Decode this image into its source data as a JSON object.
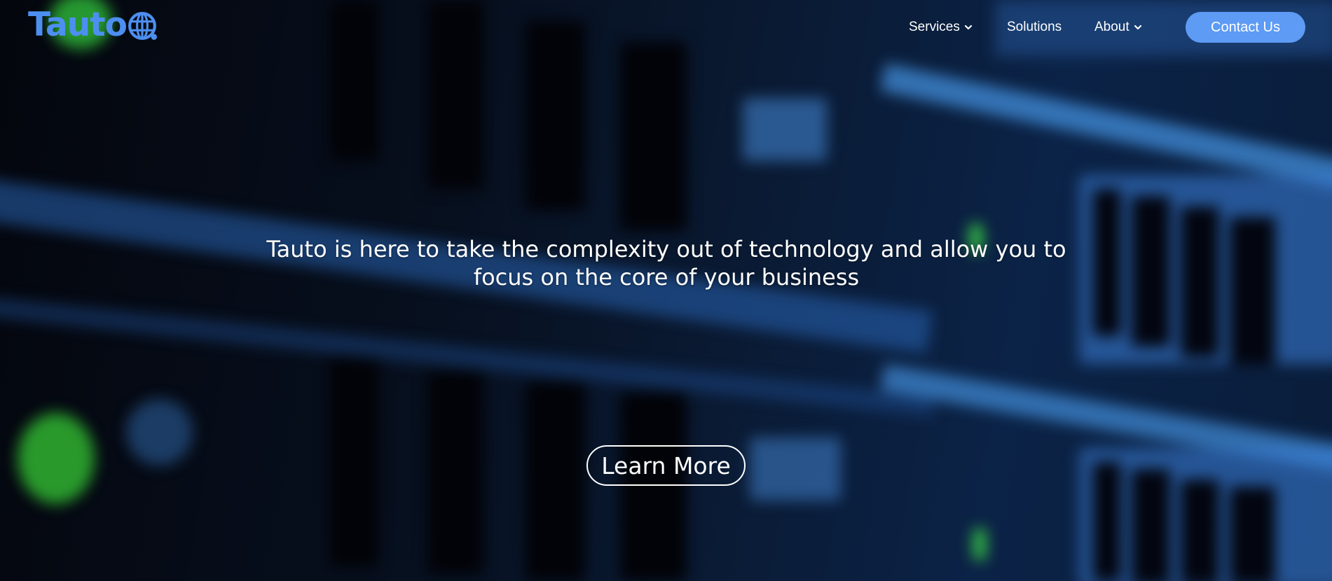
{
  "brand": {
    "name": "Tauto",
    "color": "#4d8ff0",
    "icon": "globe-icon"
  },
  "nav": {
    "items": [
      {
        "label": "Services",
        "has_dropdown": true,
        "icon": "chevron-down-icon"
      },
      {
        "label": "Solutions",
        "has_dropdown": false
      },
      {
        "label": "About",
        "has_dropdown": true,
        "icon": "chevron-down-icon"
      }
    ],
    "contact_label": "Contact Us",
    "contact_color": "#5d9bf5"
  },
  "hero": {
    "headline_line1": "Tauto is here to take the complexity out of technology and allow you to",
    "headline_line2": "focus on the core of your business",
    "cta_label": "Learn More",
    "background": "blurred server rack with blue lighting and green status LEDs"
  }
}
